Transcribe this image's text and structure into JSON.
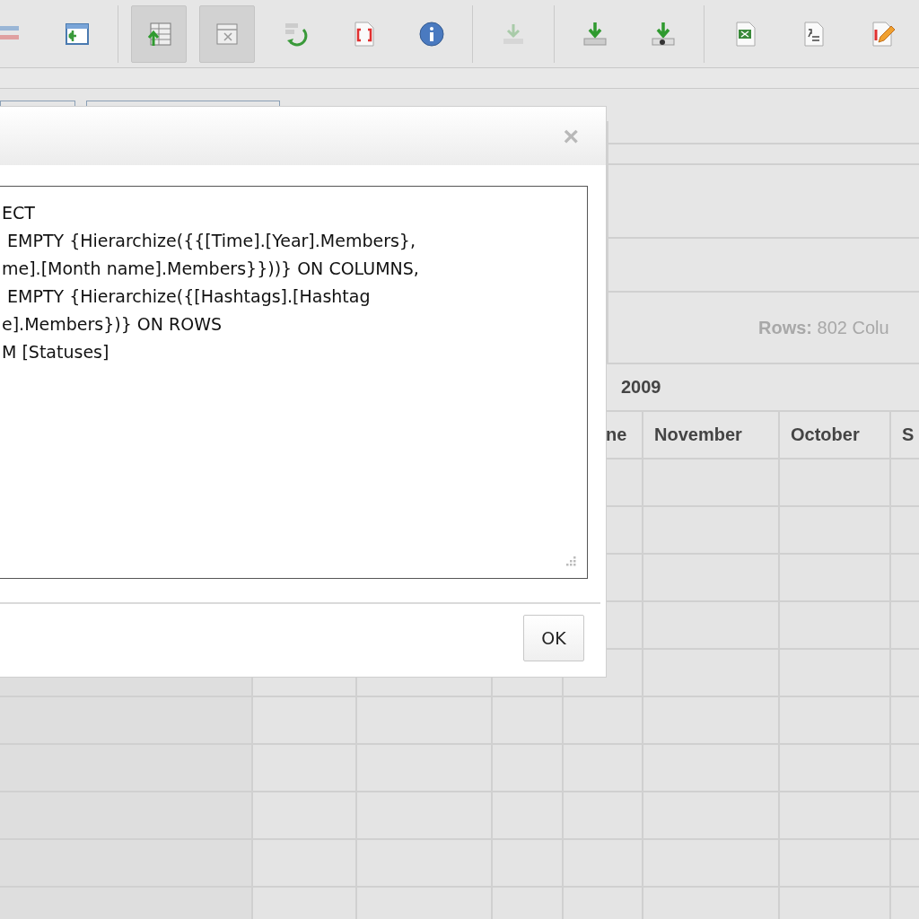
{
  "toolbar": [
    {
      "on": false,
      "disabled": false
    },
    {
      "on": false,
      "disabled": false
    },
    {
      "on": true,
      "disabled": false
    },
    {
      "on": true,
      "disabled": false
    },
    {
      "on": false,
      "disabled": false
    },
    {
      "on": false,
      "disabled": false
    },
    {
      "on": false,
      "disabled": false
    },
    {
      "on": false,
      "disabled": true
    },
    {
      "on": false,
      "disabled": false
    },
    {
      "on": false,
      "disabled": false
    },
    {
      "on": false,
      "disabled": false
    },
    {
      "on": false,
      "disabled": false
    },
    {
      "on": false,
      "disabled": false
    }
  ],
  "stats": "**Rows:** 802 Colu",
  "table": {
    "column_group": "2009",
    "columns": [
      "ne",
      "November",
      "October",
      "S"
    ]
  },
  "dialog": {
    "close": "×",
    "query_lines": [
      "ECT",
      " EMPTY {Hierarchize({{[Time].[Year].Members},",
      "me].[Month name].Members}}))} ON COLUMNS,",
      " EMPTY {Hierarchize({[Hashtags].[Hashtag",
      "e].Members})} ON ROWS",
      "M [Statuses]"
    ],
    "ok": "OK"
  }
}
